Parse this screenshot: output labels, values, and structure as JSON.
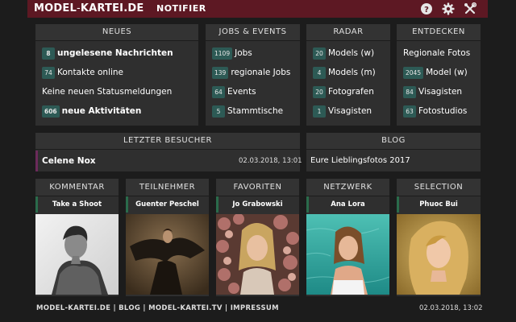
{
  "header": {
    "logo_main": "MODEL",
    "logo_dash": "-",
    "logo_rest": "KARTEI.DE",
    "title": "NOTIFIER",
    "help_icon": "help-icon",
    "settings_icon": "gear-icon",
    "tools_icon": "tools-icon"
  },
  "neues": {
    "title": "NEUES",
    "items": [
      {
        "badge": "8",
        "label": "ungelesene Nachrichten"
      },
      {
        "badge": "74",
        "label": "Kontakte online"
      },
      {
        "badge": "",
        "label": "Keine neuen Statusmeldungen"
      },
      {
        "badge": "606",
        "label": "neue Aktivitäten"
      }
    ]
  },
  "jobs": {
    "title": "JOBS & EVENTS",
    "items": [
      {
        "badge": "1109",
        "label": "Jobs"
      },
      {
        "badge": "139",
        "label": "regionale Jobs"
      },
      {
        "badge": "64",
        "label": "Events"
      },
      {
        "badge": "5",
        "label": "Stammtische"
      }
    ]
  },
  "radar": {
    "title": "RADAR",
    "items": [
      {
        "badge": "20",
        "label": "Models (w)"
      },
      {
        "badge": "4",
        "label": "Models (m)"
      },
      {
        "badge": "20",
        "label": "Fotografen"
      },
      {
        "badge": "1",
        "label": "Visagisten"
      }
    ]
  },
  "entdecken": {
    "title": "ENTDECKEN",
    "items": [
      {
        "badge": "",
        "label": "Regionale Fotos"
      },
      {
        "badge": "2045",
        "label": "Model (w)"
      },
      {
        "badge": "84",
        "label": "Visagisten"
      },
      {
        "badge": "63",
        "label": "Fotostudios"
      }
    ]
  },
  "visitor": {
    "title": "LETZTER BESUCHER",
    "name": "Celene Nox",
    "date": "02.03.2018, 13:01"
  },
  "blog": {
    "title": "BLOG",
    "entry": "Eure Lieblingsfotos 2017"
  },
  "columns": [
    {
      "title": "KOMMENTAR",
      "name": "Take a Shoot"
    },
    {
      "title": "TEILNEHMER",
      "name": "Guenter Peschel"
    },
    {
      "title": "FAVORITEN",
      "name": "Jo Grabowski"
    },
    {
      "title": "NETZWERK",
      "name": "Ana Lora"
    },
    {
      "title": "SELECTION",
      "name": "Phuoc Bui"
    }
  ],
  "footer": {
    "links": [
      "MODEL-KARTEI.DE",
      "BLOG",
      "MODEL-KARTEI.TV",
      "IMPRESSUM"
    ],
    "separator": "|",
    "timestamp": "02.03.2018, 13:02"
  },
  "colors": {
    "header_bg": "#5d1823",
    "badge_bg": "#2d5a55",
    "panel_bg": "#2f2f2f",
    "page_bg": "#1c1c1c"
  }
}
